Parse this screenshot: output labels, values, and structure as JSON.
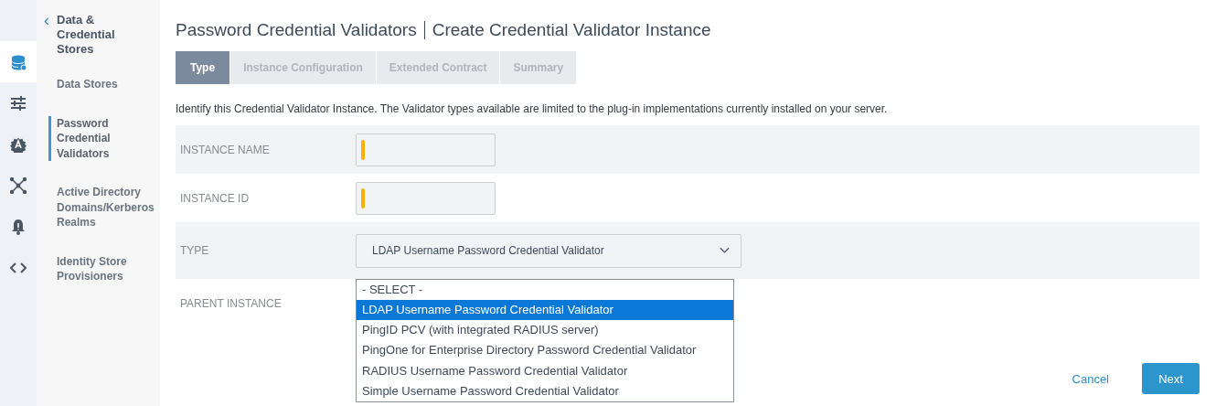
{
  "rail": [
    {
      "kind": "database",
      "selected": true
    },
    {
      "kind": "sliders",
      "selected": false
    },
    {
      "kind": "gear",
      "selected": false
    },
    {
      "kind": "network",
      "selected": false
    },
    {
      "kind": "bell",
      "selected": false
    },
    {
      "kind": "code",
      "selected": false
    }
  ],
  "subnav": {
    "back": "‹",
    "title": "Data & Credential Stores",
    "items": [
      {
        "label": "Data Stores",
        "selected": false
      },
      {
        "label": "Password Credential Validators",
        "selected": true
      },
      {
        "label": "Active Directory Domains/Kerberos Realms",
        "selected": false
      },
      {
        "label": "Identity Store Provisioners",
        "selected": false
      }
    ]
  },
  "page": {
    "title": "Password Credential Validators",
    "subtitle": "Create Credential Validator Instance"
  },
  "tabs": [
    {
      "label": "Type",
      "selected": true
    },
    {
      "label": "Instance Configuration",
      "selected": false
    },
    {
      "label": "Extended Contract",
      "selected": false
    },
    {
      "label": "Summary",
      "selected": false
    }
  ],
  "description": "Identify this Credential Validator Instance. The Validator types available are limited to the plug-in implementations currently installed on your server.",
  "form": [
    {
      "label": "INSTANCE NAME",
      "kind": "text",
      "required": true
    },
    {
      "label": "INSTANCE ID",
      "kind": "text",
      "required": true
    },
    {
      "label": "TYPE",
      "kind": "select",
      "value": "LDAP Username Password Credential Validator",
      "options": [
        {
          "label": "- SELECT -",
          "selected": false
        },
        {
          "label": "LDAP Username Password Credential Validator",
          "selected": true
        },
        {
          "label": "PingID PCV (with integrated RADIUS server)",
          "selected": false
        },
        {
          "label": "PingOne for Enterprise Directory Password Credential Validator",
          "selected": false
        },
        {
          "label": "RADIUS Username Password Credential Validator",
          "selected": false
        },
        {
          "label": "Simple Username Password Credential Validator",
          "selected": false
        }
      ]
    },
    {
      "label": "PARENT INSTANCE",
      "kind": "hidden"
    }
  ],
  "buttons": [
    {
      "label": "Cancel",
      "kind": "link"
    },
    {
      "label": "Next",
      "kind": "primary"
    }
  ]
}
